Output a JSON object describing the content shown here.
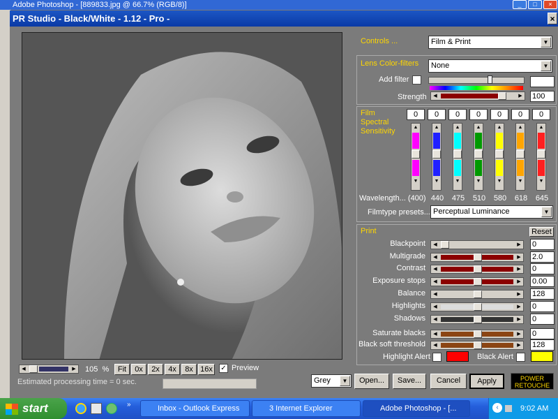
{
  "photoshop": {
    "title": "Adobe Photoshop - [889833.jpg @ 66.7% (RGB/8)]"
  },
  "window": {
    "title": "PR Studio - Black/White - 1.12 - Pro -",
    "close": "×"
  },
  "controls": {
    "label": "Controls ...",
    "value": "Film & Print"
  },
  "lens": {
    "label": "Lens Color-filters",
    "value": "None",
    "add_filter_label": "Add filter",
    "strength_label": "Strength",
    "strength_value": "100",
    "strength_level": 0.85
  },
  "film": {
    "label_lines": [
      "Film",
      "Spectral",
      "Sensitivity"
    ],
    "wavelength_label": "Wavelength... (400)",
    "channels": [
      {
        "value": "0",
        "wavelength": "440",
        "color": "#ff00ff"
      },
      {
        "value": "0",
        "wavelength": "475",
        "color": "#2020ff"
      },
      {
        "value": "0",
        "wavelength": "510",
        "color": "#00ffff"
      },
      {
        "value": "0",
        "wavelength": "580",
        "color": "#009900"
      },
      {
        "value": "0",
        "wavelength": "618",
        "color": "#ffff00"
      },
      {
        "value": "0",
        "wavelength": "645",
        "color": "#ffa500"
      },
      {
        "value": "0",
        "wavelength": "",
        "color": "#ff2020"
      }
    ],
    "presets_label": "Filmtype presets...",
    "presets_value": "Perceptual Luminance"
  },
  "print": {
    "label": "Print",
    "reset": "Reset",
    "rows": [
      {
        "label": "Blackpoint",
        "value": "0",
        "color": "#d4d0c8",
        "level": 0.0
      },
      {
        "label": "Multigrade",
        "value": "2.0",
        "color": "#8b0000",
        "level": 0.5
      },
      {
        "label": "Contrast",
        "value": "0",
        "color": "#8b0000",
        "level": 0.5
      },
      {
        "label": "Exposure stops",
        "value": "0.00",
        "color": "#8b0000",
        "level": 0.5
      },
      {
        "label": "Balance",
        "value": "128",
        "color": "#d4d0c8",
        "level": 0.5
      },
      {
        "label": "Highlights",
        "value": "0",
        "color": "#dcdcdc",
        "level": 0.5
      },
      {
        "label": "Shadows",
        "value": "0",
        "color": "#333333",
        "level": 0.5
      },
      {
        "label": "Saturate blacks",
        "value": "0",
        "color": "#8b4513",
        "level": 0.5
      },
      {
        "label": "Black soft threshold",
        "value": "128",
        "color": "#8b4513",
        "level": 0.5
      }
    ],
    "highlight_alert": "Highlight Alert",
    "highlight_color": "#ff0000",
    "black_alert": "Black Alert",
    "black_color": "#ffff00"
  },
  "zoom": {
    "value": "105",
    "unit": "%",
    "buttons": [
      "Fit",
      "0x",
      "2x",
      "4x",
      "8x",
      "16x"
    ],
    "preview_label": "Preview",
    "processing": "Estimated processing time = 0 sec."
  },
  "footer": {
    "mode": "Grey",
    "open": "Open...",
    "save": "Save...",
    "cancel": "Cancel",
    "apply": "Apply",
    "logo_line1": "POWER",
    "logo_line2": "RETOUCHE"
  },
  "taskbar": {
    "start": "start",
    "tasks": [
      {
        "label": "Inbox - Outlook Express"
      },
      {
        "label": "3 Internet Explorer"
      },
      {
        "label": "Adobe Photoshop - [..."
      }
    ],
    "clock": "9:02 AM"
  }
}
